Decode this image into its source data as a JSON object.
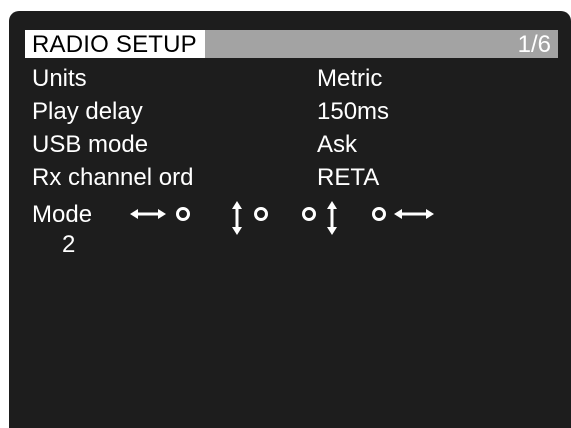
{
  "header": {
    "title": "RADIO SETUP",
    "page": "1/6"
  },
  "settings": [
    {
      "label": "Units",
      "value": "Metric"
    },
    {
      "label": "Play delay",
      "value": "150ms"
    },
    {
      "label": "USB mode",
      "value": "Ask"
    },
    {
      "label": "Rx channel ord",
      "value": "RETA"
    }
  ],
  "mode": {
    "label": "Mode",
    "value": "2",
    "icons": [
      "horizontal-arrow-circle-icon",
      "vertical-arrow-circle-icon",
      "circle-vertical-arrow-icon",
      "circle-horizontal-arrow-icon"
    ]
  },
  "colors": {
    "screen_bg": "#1d1d1d",
    "title_bar": "#a3a3a3",
    "highlight_bg": "#ffffff",
    "text": "#ffffff"
  }
}
